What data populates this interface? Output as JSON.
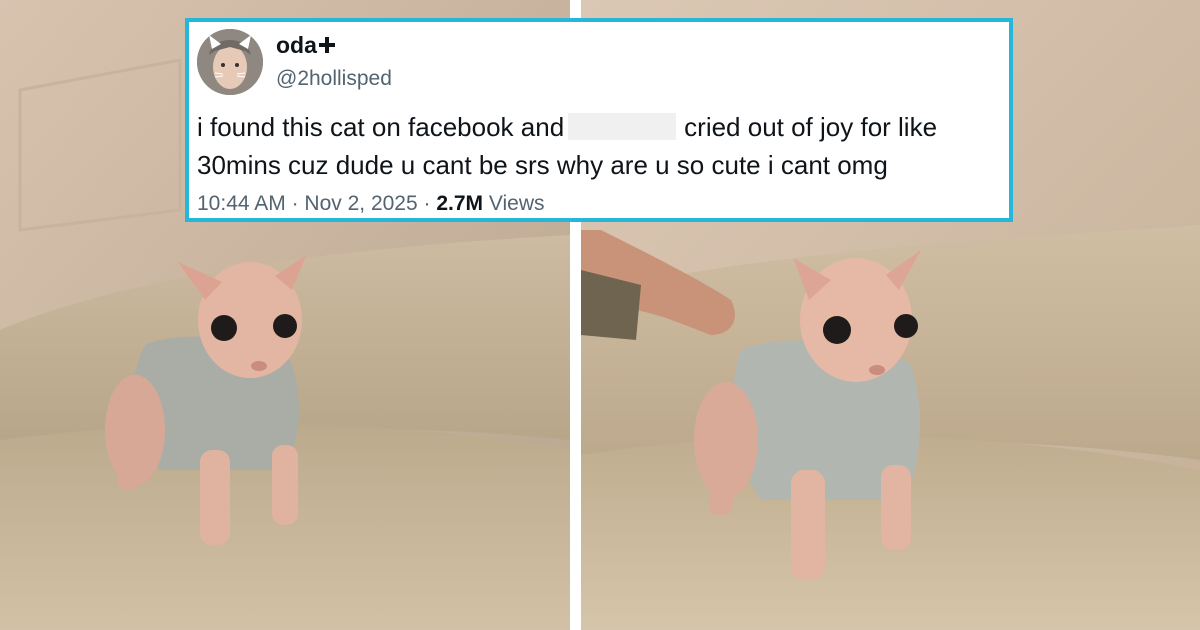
{
  "tweet": {
    "display_name": "oda",
    "badge_icon": "plus-cross-icon",
    "handle": "@2hollisped",
    "text_before_redaction": "i found this cat on facebook and",
    "text_after_redaction": "cried out of joy for like",
    "text_line2": "30mins cuz dude u cant be srs why are u so cute i cant omg",
    "time": "10:44 AM",
    "separator": "·",
    "date": "Nov 2, 2025",
    "views_count": "2.7M",
    "views_label": "Views"
  },
  "colors": {
    "card_border": "#25b6d9",
    "text_primary": "#0f1419",
    "text_secondary": "#536471"
  }
}
